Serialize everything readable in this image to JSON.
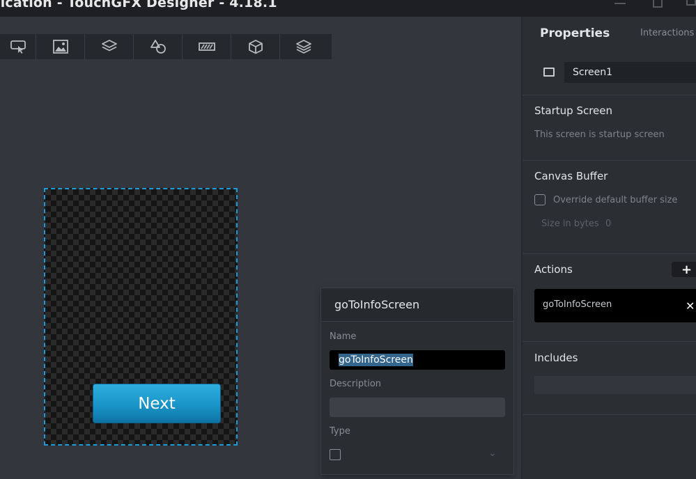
{
  "window": {
    "title": "lication - TouchGFX Designer - 4.18.1"
  },
  "toolbar": {
    "tools": [
      {
        "icon": "interaction-icon"
      },
      {
        "icon": "image-icon"
      },
      {
        "icon": "container-icon"
      },
      {
        "icon": "shapes-icon"
      },
      {
        "icon": "progress-icon"
      },
      {
        "icon": "3d-box-icon"
      },
      {
        "icon": "layers-icon"
      }
    ]
  },
  "canvas": {
    "button_label": "Next"
  },
  "popup": {
    "title": "goToInfoScreen",
    "name_label": "Name",
    "name_value": "goToInfoScreen",
    "description_label": "Description",
    "description_value": "",
    "type_label": "Type"
  },
  "sidebar": {
    "tab_properties": "Properties",
    "tab_interactions": "Interactions",
    "screen_name": "Screen1",
    "startup": {
      "title": "Startup Screen",
      "text": "This screen is startup screen"
    },
    "canvas_buffer": {
      "title": "Canvas Buffer",
      "override_label": "Override default buffer size",
      "size_label": "Size in bytes",
      "size_value": "0"
    },
    "actions": {
      "title": "Actions",
      "add": "+",
      "items": [
        {
          "label": "goToInfoScreen",
          "remove": "✕"
        }
      ]
    },
    "includes": {
      "title": "Includes"
    }
  },
  "colors": {
    "accent": "#1c9bdb",
    "button": "#1a94c8",
    "selection": "#34658c"
  }
}
